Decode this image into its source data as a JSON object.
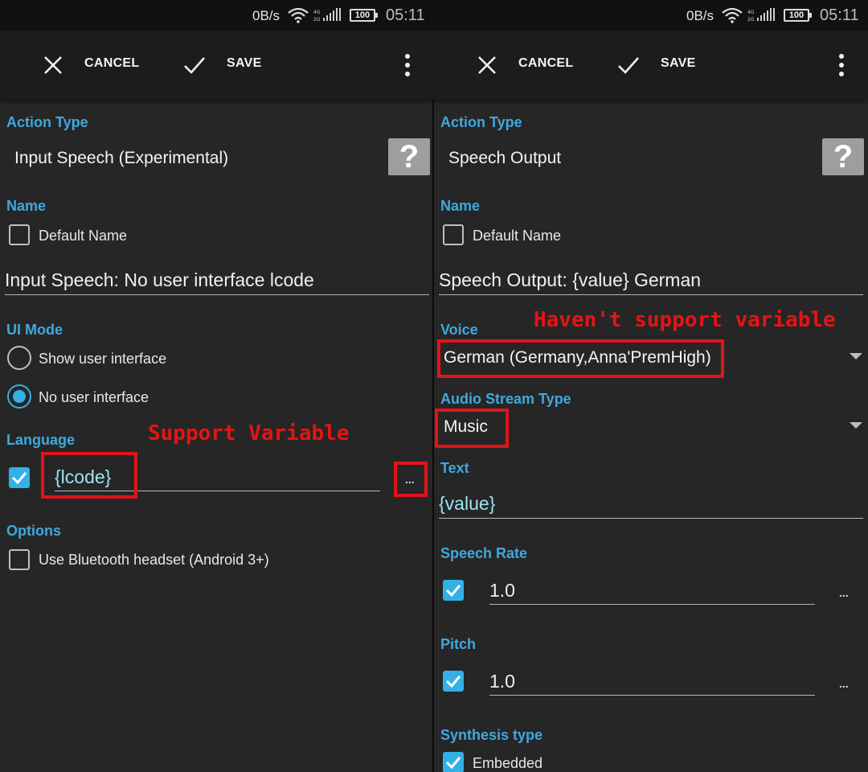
{
  "status_bar": {
    "net_speed": "0B/s",
    "battery": "100",
    "time": "05:11"
  },
  "toolbar": {
    "cancel_label": "CANCEL",
    "save_label": "SAVE"
  },
  "left": {
    "action_type_label": "Action Type",
    "action_type_value": "Input Speech (Experimental)",
    "help_glyph": "?",
    "name_label": "Name",
    "default_name_label": "Default Name",
    "name_value": "Input Speech: No user interface lcode",
    "ui_mode_label": "UI Mode",
    "ui_mode_options": [
      "Show user interface",
      "No user interface"
    ],
    "language_label": "Language",
    "language_value": "{lcode}",
    "ellipsis": "...",
    "options_label": "Options",
    "bluetooth_label": "Use Bluetooth headset (Android 3+)",
    "annotation": "Support Variable"
  },
  "right": {
    "action_type_label": "Action Type",
    "action_type_value": "Speech Output",
    "help_glyph": "?",
    "name_label": "Name",
    "default_name_label": "Default Name",
    "name_value": "Speech Output: {value} German",
    "voice_label": "Voice",
    "voice_value": "German (Germany,Anna'PremHigh)",
    "audio_stream_label": "Audio Stream Type",
    "audio_stream_value": "Music",
    "text_label": "Text",
    "text_value": "{value}",
    "speech_rate_label": "Speech Rate",
    "speech_rate_value": "1.0",
    "pitch_label": "Pitch",
    "pitch_value": "1.0",
    "ellipsis": "...",
    "synthesis_label": "Synthesis type",
    "synthesis_value": "Embedded",
    "annotation": "Haven't support variable"
  },
  "colors": {
    "accent": "#33b0e6",
    "label_blue": "#3ea9df",
    "annotation_red": "#e0141b",
    "background": "#262626"
  }
}
